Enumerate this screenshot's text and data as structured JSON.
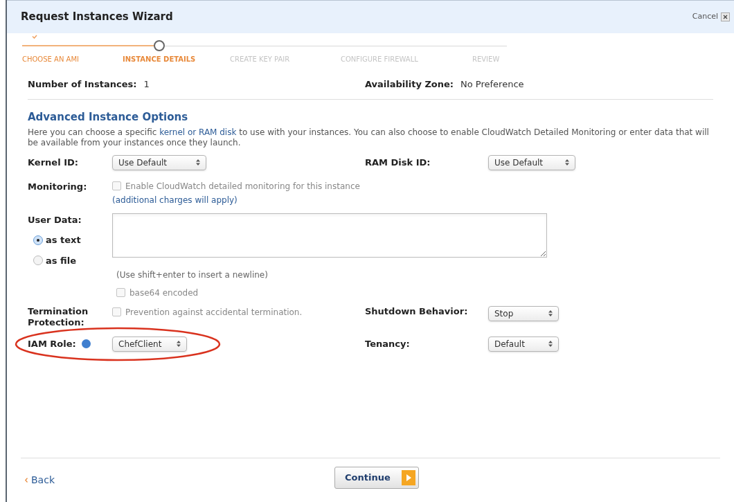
{
  "window": {
    "title": "Request Instances Wizard",
    "cancel": "Cancel"
  },
  "steps": [
    {
      "label": "CHOOSE AN AMI",
      "done": true,
      "selected": false
    },
    {
      "label": "INSTANCE DETAILS",
      "done": false,
      "selected": true
    },
    {
      "label": "CREATE KEY PAIR",
      "done": false,
      "selected": false
    },
    {
      "label": "CONFIGURE FIREWALL",
      "done": false,
      "selected": false
    },
    {
      "label": "REVIEW",
      "done": false,
      "selected": false
    }
  ],
  "summary": {
    "instances_label": "Number of Instances:",
    "instances_value": "1",
    "zone_label": "Availability Zone:",
    "zone_value": "No Preference"
  },
  "section": {
    "title": "Advanced Instance Options",
    "text_before": "Here you can choose a specific ",
    "link": "kernel or RAM disk",
    "text_after": " to use with your instances. You can also choose to enable CloudWatch Detailed Monitoring or enter data that will be available from your instances once they launch."
  },
  "kernel": {
    "label": "Kernel ID:",
    "value": "Use Default"
  },
  "ramdisk": {
    "label": "RAM Disk ID:",
    "value": "Use Default"
  },
  "monitoring": {
    "label": "Monitoring:",
    "checkbox": "Enable CloudWatch detailed monitoring for this instance",
    "checked": false,
    "note": "(additional charges will apply)"
  },
  "user_data": {
    "label": "User Data:",
    "options": [
      {
        "label": "as text",
        "selected": true
      },
      {
        "label": "as file",
        "selected": false
      }
    ],
    "hint": "(Use shift+enter to insert a newline)",
    "base64": "base64 encoded",
    "base64_checked": false
  },
  "termination": {
    "label": "Termination Protection:",
    "checkbox": "Prevention against accidental termination.",
    "checked": false
  },
  "shutdown": {
    "label": "Shutdown Behavior:",
    "value": "Stop"
  },
  "iam": {
    "label": "IAM Role:",
    "value": "ChefClient",
    "highlighted": true
  },
  "tenancy": {
    "label": "Tenancy:",
    "value": "Default"
  },
  "footer": {
    "back": "Back",
    "continue": "Continue"
  }
}
